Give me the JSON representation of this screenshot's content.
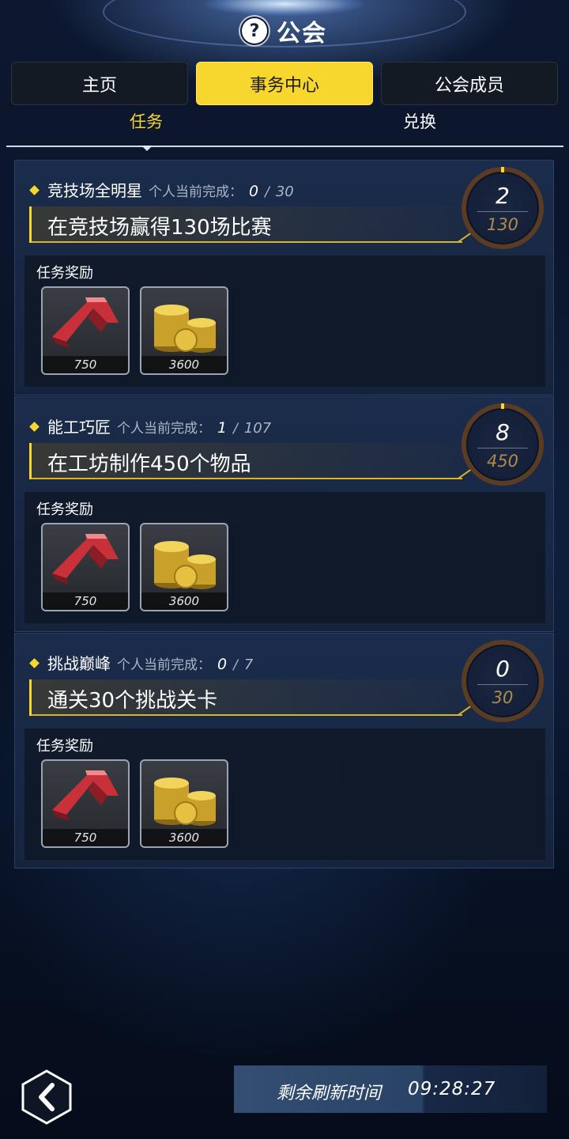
{
  "header": {
    "title": "公会",
    "help_icon": "help-icon"
  },
  "tabs": [
    {
      "label": "主页",
      "active": false
    },
    {
      "label": "事务中心",
      "active": true
    },
    {
      "label": "公会成员",
      "active": false
    }
  ],
  "subtabs": [
    {
      "label": "任务",
      "active": true
    },
    {
      "label": "兑换",
      "active": false
    }
  ],
  "tasks": [
    {
      "name": "竞技场全明星",
      "progress_label": "个人当前完成：",
      "progress_current": "0",
      "progress_sep": "/",
      "progress_total": "30",
      "title": "在竞技场赢得130场比赛",
      "ring_current": "2",
      "ring_total": "130",
      "reward_label": "任务奖励",
      "rewards": [
        {
          "icon": "red-chevron-icon",
          "count": "750"
        },
        {
          "icon": "gold-coins-icon",
          "count": "3600"
        }
      ]
    },
    {
      "name": "能工巧匠",
      "progress_label": "个人当前完成：",
      "progress_current": "1",
      "progress_sep": "/",
      "progress_total": "107",
      "title": "在工坊制作450个物品",
      "ring_current": "8",
      "ring_total": "450",
      "reward_label": "任务奖励",
      "rewards": [
        {
          "icon": "red-chevron-icon",
          "count": "750"
        },
        {
          "icon": "gold-coins-icon",
          "count": "3600"
        }
      ]
    },
    {
      "name": "挑战巅峰",
      "progress_label": "个人当前完成：",
      "progress_current": "0",
      "progress_sep": "/",
      "progress_total": "7",
      "title": "通关30个挑战关卡",
      "ring_current": "0",
      "ring_total": "30",
      "reward_label": "任务奖励",
      "rewards": [
        {
          "icon": "red-chevron-icon",
          "count": "750"
        },
        {
          "icon": "gold-coins-icon",
          "count": "3600"
        }
      ]
    }
  ],
  "footer": {
    "back_icon": "back-chevron-icon",
    "refresh_label": "剩余刷新时间",
    "refresh_time": "09:28:27"
  },
  "colors": {
    "accent": "#f7d62e",
    "ring_border": "#5a3c24",
    "ring_total_text": "#b08a4a"
  }
}
